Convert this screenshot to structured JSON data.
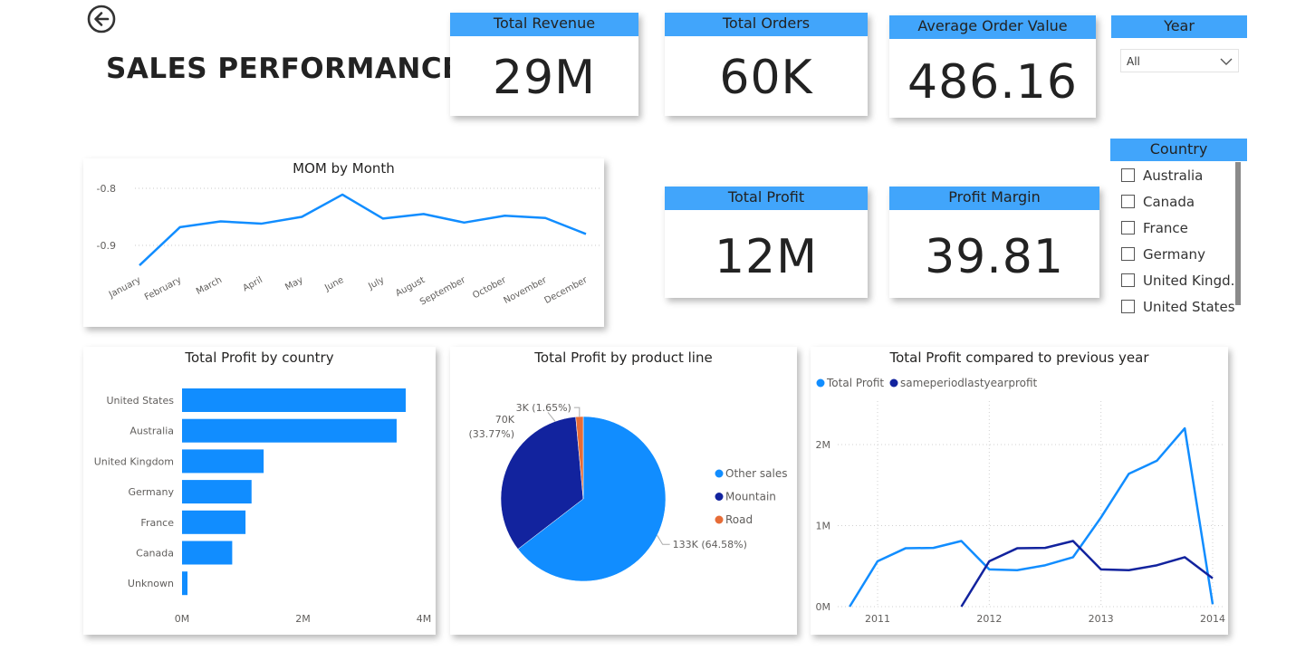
{
  "header": {
    "title": "SALES PERFORMANCE",
    "back_icon": "back-arrow-icon"
  },
  "kpis": {
    "total_revenue": {
      "label": "Total Revenue",
      "value": "29M"
    },
    "total_orders": {
      "label": "Total Orders",
      "value": "60K"
    },
    "avg_order_value": {
      "label": "Average Order Value",
      "value": "486.16"
    },
    "total_profit": {
      "label": "Total Profit",
      "value": "12M"
    },
    "profit_margin": {
      "label": "Profit Margin",
      "value": "39.81"
    }
  },
  "year_slicer": {
    "label": "Year",
    "selected": "All"
  },
  "country_slicer": {
    "label": "Country",
    "items": [
      "Australia",
      "Canada",
      "France",
      "Germany",
      "United Kingd..",
      "United States"
    ]
  },
  "colors": {
    "accent": "#41a5fb",
    "series_light": "#118dff",
    "series_dark": "#12239e",
    "road": "#e66c37"
  },
  "chart_data": [
    {
      "type": "line",
      "title": "MOM by Month",
      "categories": [
        "January",
        "February",
        "March",
        "April",
        "May",
        "June",
        "July",
        "August",
        "September",
        "October",
        "November",
        "December"
      ],
      "values": [
        -0.935,
        -0.868,
        -0.858,
        -0.862,
        -0.85,
        -0.811,
        -0.853,
        -0.845,
        -0.86,
        -0.848,
        -0.852,
        -0.88
      ],
      "yticks": [
        -0.8,
        -0.9
      ],
      "ytick_labels": [
        "-0.8",
        "-0.9"
      ],
      "grid": true
    },
    {
      "type": "bar",
      "orientation": "horizontal",
      "title": "Total Profit by country",
      "categories": [
        "United States",
        "Australia",
        "United Kingdom",
        "Germany",
        "France",
        "Canada",
        "Unknown"
      ],
      "values": [
        3700000,
        3550000,
        1350000,
        1150000,
        1050000,
        830000,
        90000
      ],
      "xlim": [
        0,
        4000000
      ],
      "xticks": [
        0,
        2000000,
        4000000
      ],
      "xtick_labels": [
        "0M",
        "2M",
        "4M"
      ]
    },
    {
      "type": "pie",
      "title": "Total Profit by product line",
      "labels": [
        "Other sales",
        "Mountain",
        "Road"
      ],
      "values": [
        133,
        70,
        3
      ],
      "value_labels": [
        "133K (64.58%)",
        "70K (33.77%)",
        "3K (1.65%)"
      ],
      "legend": "right"
    },
    {
      "type": "line",
      "title": "Total Profit compared to previous year",
      "legend": "top-left",
      "xticks": [
        2011,
        2012,
        2013,
        2014
      ],
      "xtick_labels": [
        "2011",
        "2012",
        "2013",
        "2014"
      ],
      "yticks": [
        0,
        1000000,
        2000000
      ],
      "ytick_labels": [
        "0M",
        "1M",
        "2M"
      ],
      "ylim": [
        0,
        2300000
      ],
      "series": [
        {
          "name": "Total Profit",
          "x": [
            2010.75,
            2011.0,
            2011.25,
            2011.5,
            2011.75,
            2012.0,
            2012.25,
            2012.5,
            2012.75,
            2013.0,
            2013.25,
            2013.5,
            2013.75,
            2014.0
          ],
          "values": [
            0,
            560000,
            720000,
            725000,
            810000,
            460000,
            450000,
            510000,
            610000,
            1100000,
            1640000,
            1800000,
            2200000,
            30000
          ]
        },
        {
          "name": "sameperiodlastyearprofit",
          "x": [
            2011.75,
            2012.0,
            2012.25,
            2012.5,
            2012.75,
            2013.0,
            2013.25,
            2013.5,
            2013.75,
            2014.0
          ],
          "values": [
            0,
            560000,
            720000,
            725000,
            810000,
            460000,
            450000,
            510000,
            610000,
            350000
          ]
        }
      ]
    }
  ]
}
